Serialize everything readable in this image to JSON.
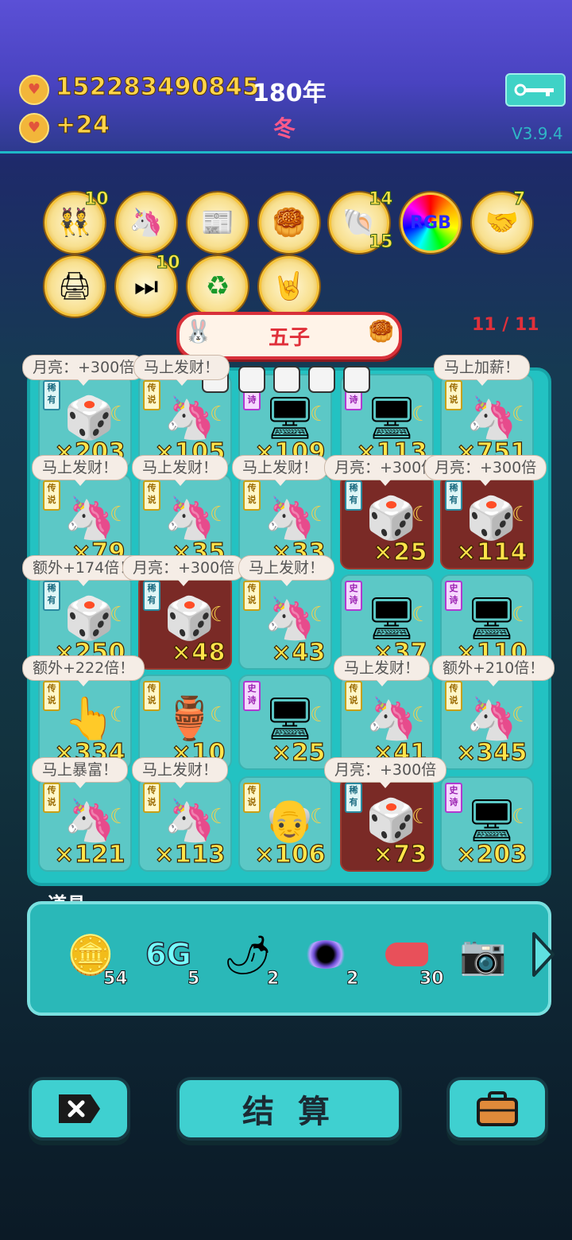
{
  "top": {
    "money": "152283490845",
    "year": "180年",
    "income": "+24",
    "season": "冬",
    "version": "V3.9.4"
  },
  "relics": [
    {
      "name": "twins-unicorn",
      "count": "10"
    },
    {
      "name": "unicorn-heart",
      "count": ""
    },
    {
      "name": "time-magazine",
      "count": ""
    },
    {
      "name": "mooncake",
      "count": ""
    },
    {
      "name": "seashell",
      "count": "14",
      "count2": "15"
    },
    {
      "name": "rgb",
      "label": "RGB",
      "count": ""
    },
    {
      "name": "handshake",
      "count": "7"
    },
    {
      "name": "printer",
      "count": ""
    },
    {
      "name": "skip",
      "count": "10"
    },
    {
      "name": "recycle",
      "count": ""
    },
    {
      "name": "rock-hand",
      "count": ""
    }
  ],
  "banner": {
    "title": "五子"
  },
  "spins": "11 / 11",
  "rarity": {
    "rare": "稀有",
    "legend": "传说",
    "epic": "史诗"
  },
  "bubbles": {
    "moon300": "月亮：+300倍",
    "fortune": "马上发财！",
    "raise": "马上加薪！",
    "extra174": "额外+174倍！",
    "extra222": "额外+222倍！",
    "extra210": "额外+210倍！",
    "rich": "马上暴富！"
  },
  "board": [
    [
      {
        "tag": "rare",
        "m": "×203"
      },
      {
        "tag": "legend",
        "m": "×105"
      },
      {
        "tag": "epic",
        "m": "×109"
      },
      {
        "tag": "epic",
        "m": "×113"
      },
      {
        "tag": "legend",
        "m": "×751"
      }
    ],
    [
      {
        "tag": "legend",
        "m": "×79"
      },
      {
        "tag": "legend",
        "m": "×35"
      },
      {
        "tag": "legend",
        "m": "×33"
      },
      {
        "tag": "rare",
        "m": "×25"
      },
      {
        "tag": "rare",
        "m": "×114"
      }
    ],
    [
      {
        "tag": "rare",
        "m": "×250"
      },
      {
        "tag": "rare",
        "m": "×48"
      },
      {
        "tag": "legend",
        "m": "×43"
      },
      {
        "tag": "epic",
        "m": "×37"
      },
      {
        "tag": "epic",
        "m": "×110"
      }
    ],
    [
      {
        "tag": "legend",
        "m": "×334"
      },
      {
        "tag": "legend",
        "m": "×10"
      },
      {
        "tag": "epic",
        "m": "×25"
      },
      {
        "tag": "legend",
        "m": "×41"
      },
      {
        "tag": "legend",
        "m": "×345"
      }
    ],
    [
      {
        "tag": "legend",
        "m": "×121"
      },
      {
        "tag": "legend",
        "m": "×113"
      },
      {
        "tag": "legend",
        "m": "×106"
      },
      {
        "tag": "rare",
        "m": "×73"
      },
      {
        "tag": "epic",
        "m": "×203"
      }
    ]
  ],
  "items": {
    "label": "道具",
    "list": [
      {
        "name": "coin",
        "count": "54"
      },
      {
        "name": "6g",
        "label": "6G",
        "count": "5"
      },
      {
        "name": "chili",
        "count": "2"
      },
      {
        "name": "black-hole",
        "count": "2"
      },
      {
        "name": "liver",
        "count": "30"
      },
      {
        "name": "camera",
        "count": ""
      }
    ]
  },
  "bottom": {
    "settle": "结 算"
  }
}
